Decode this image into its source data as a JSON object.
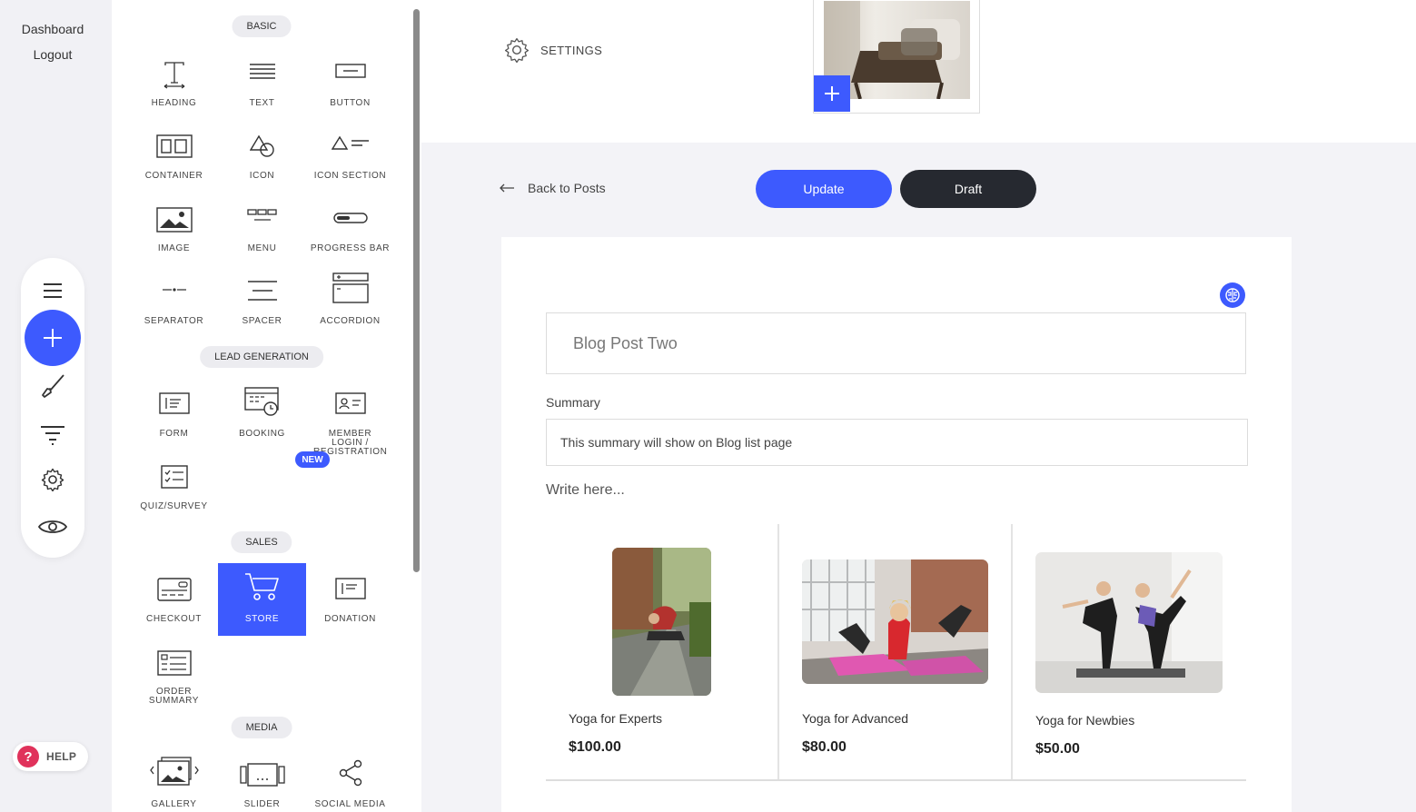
{
  "rail": {
    "dashboard": "Dashboard",
    "logout": "Logout",
    "help": "HELP",
    "tools": [
      "menu-icon",
      "add-icon",
      "brush-icon",
      "filter-icon",
      "gear-icon",
      "eye-icon"
    ]
  },
  "panel": {
    "sections": {
      "basic": "BASIC",
      "lead": "LEAD GENERATION",
      "sales": "SALES",
      "media": "MEDIA"
    },
    "widgets": {
      "heading": "HEADING",
      "text": "TEXT",
      "button": "BUTTON",
      "container": "CONTAINER",
      "icon": "ICON",
      "icon_section": "ICON SECTION",
      "image": "IMAGE",
      "menu": "MENU",
      "progress_bar": "PROGRESS BAR",
      "separator": "SEPARATOR",
      "spacer": "SPACER",
      "accordion": "ACCORDION",
      "form": "FORM",
      "booking": "BOOKING",
      "member_login": "MEMBER LOGIN / REGISTRATION",
      "quiz": "QUIZ/SURVEY",
      "checkout": "CHECKOUT",
      "store": "STORE",
      "donation": "DONATION",
      "order_summary": "ORDER SUMMARY",
      "gallery": "GALLERY",
      "slider": "SLIDER",
      "social_media": "SOCIAL MEDIA"
    },
    "new_badge": "NEW",
    "active_widget": "STORE"
  },
  "header": {
    "settings": "SETTINGS"
  },
  "toolbar": {
    "back": "Back to Posts",
    "update": "Update",
    "draft": "Draft"
  },
  "editor": {
    "title": "Blog Post Two",
    "summary_label": "Summary",
    "summary_value": "This summary will show on Blog list page",
    "body_placeholder": "Write here...",
    "products": [
      {
        "name": "Yoga for Experts",
        "price": "$100.00"
      },
      {
        "name": "Yoga for Advanced",
        "price": "$80.00"
      },
      {
        "name": "Yoga for Newbies",
        "price": "$50.00"
      }
    ]
  },
  "colors": {
    "accent": "#3d5afe",
    "dark_button": "#262930",
    "help_red": "#e0325b"
  }
}
